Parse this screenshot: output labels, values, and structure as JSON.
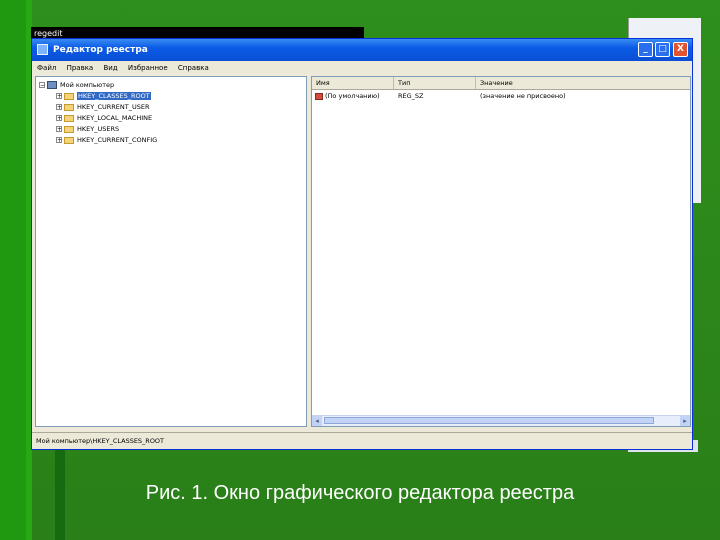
{
  "background_window": {
    "title": "regedit"
  },
  "window": {
    "title": "Редактор реестра",
    "buttons": {
      "minimize": "_",
      "maximize": "□",
      "close": "X"
    }
  },
  "menu": [
    "Файл",
    "Правка",
    "Вид",
    "Избранное",
    "Справка"
  ],
  "tree": {
    "root": "Мой компьютер",
    "items": [
      "HKEY_CLASSES_ROOT",
      "HKEY_CURRENT_USER",
      "HKEY_LOCAL_MACHINE",
      "HKEY_USERS",
      "HKEY_CURRENT_CONFIG"
    ]
  },
  "list": {
    "columns": [
      "Имя",
      "Тип",
      "Значение"
    ],
    "rows": [
      {
        "name": "(По умолчанию)",
        "type": "REG_SZ",
        "value": "(значение не присвоено)"
      }
    ]
  },
  "status": "Мой компьютер\\HKEY_CLASSES_ROOT",
  "caption": "Рис. 1. Окно графического редактора реестра",
  "colors": {
    "slide_background": "#2f8a1a",
    "titlebar": "#0b5be6",
    "selection": "#316ac5"
  }
}
